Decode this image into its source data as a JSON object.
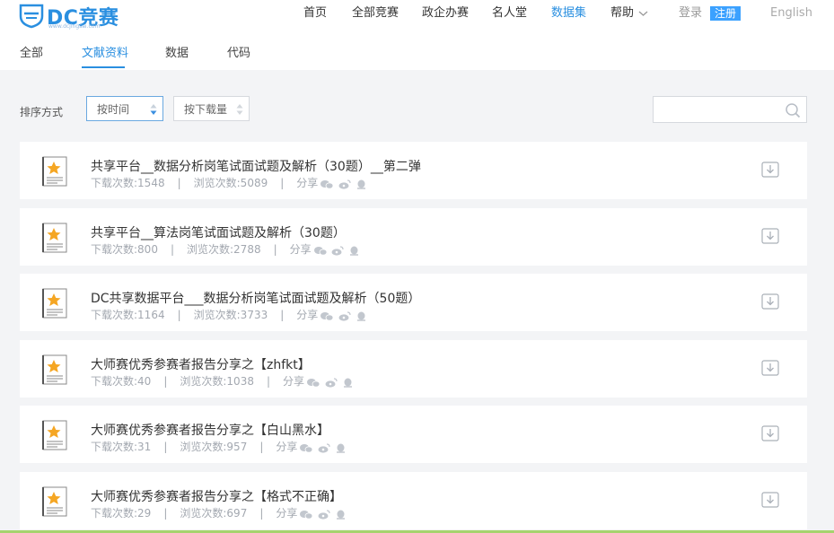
{
  "brand": {
    "name": "DC竞赛",
    "url": "www.dcjingsai.com",
    "color": "#2a8fe0"
  },
  "nav": {
    "items": [
      {
        "label": "首页"
      },
      {
        "label": "全部竞赛"
      },
      {
        "label": "政企办赛"
      },
      {
        "label": "名人堂"
      },
      {
        "label": "数据集"
      },
      {
        "label": "帮助"
      }
    ],
    "login": "登录",
    "register": "注册",
    "language": "English"
  },
  "tabs": [
    {
      "label": "全部"
    },
    {
      "label": "文献资料"
    },
    {
      "label": "数据"
    },
    {
      "label": "代码"
    }
  ],
  "sort": {
    "label": "排序方式",
    "by_time": "按时间",
    "by_downloads": "按下载量"
  },
  "search": {
    "placeholder": ""
  },
  "documents": [
    {
      "title": "共享平台__数据分析岗笔试面试题及解析（30题）__第二弹",
      "downloads": "下载次数:1548",
      "views": "浏览次数:5089",
      "share": "分享"
    },
    {
      "title": "共享平台__算法岗笔试面试题及解析（30题）",
      "downloads": "下载次数:800",
      "views": "浏览次数:2788",
      "share": "分享"
    },
    {
      "title": "DC共享数据平台___数据分析岗笔试面试题及解析（50题）",
      "downloads": "下载次数:1164",
      "views": "浏览次数:3733",
      "share": "分享"
    },
    {
      "title": "大师赛优秀参赛者报告分享之【zhfkt】",
      "downloads": "下载次数:40",
      "views": "浏览次数:1038",
      "share": "分享"
    },
    {
      "title": "大师赛优秀参赛者报告分享之【白山黑水】",
      "downloads": "下载次数:31",
      "views": "浏览次数:957",
      "share": "分享"
    },
    {
      "title": "大师赛优秀参赛者报告分享之【格式不正确】",
      "downloads": "下载次数:29",
      "views": "浏览次数:697",
      "share": "分享"
    }
  ],
  "separator": "|",
  "colors": {
    "accent": "#2a8fe0",
    "register_bg": "#3ba1ff",
    "star": "#f5a623",
    "page_bg": "#f3f4f6"
  }
}
